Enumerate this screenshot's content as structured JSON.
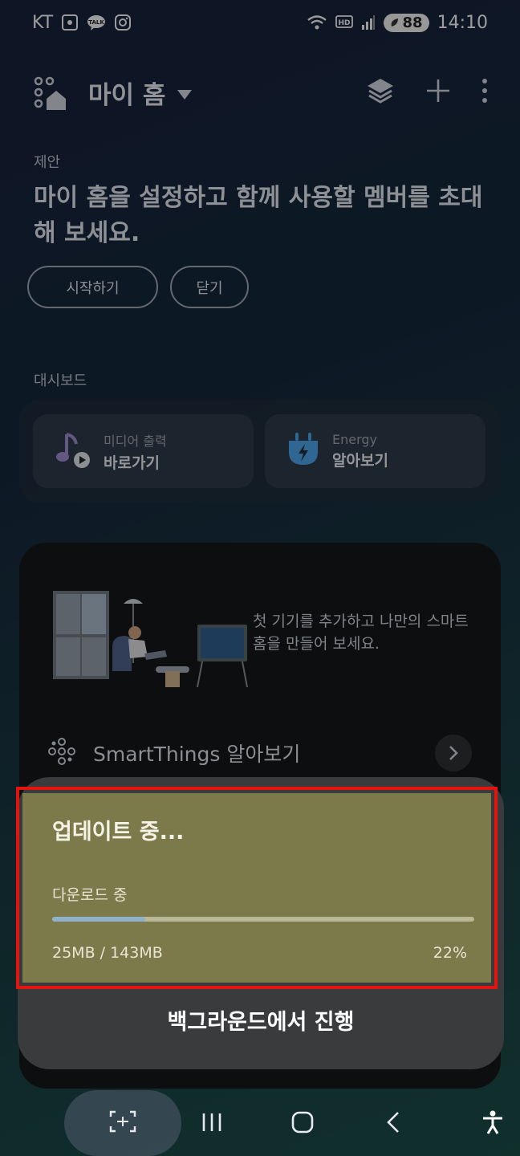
{
  "status_bar": {
    "carrier": "KT",
    "battery": "88",
    "time": "14:10"
  },
  "header": {
    "title": "마이 홈"
  },
  "suggestion": {
    "label": "제안",
    "text": "마이 홈을 설정하고 함께 사용할 멤버를 초대해 보세요.",
    "start_button": "시작하기",
    "close_button": "닫기"
  },
  "dashboard": {
    "label": "대시보드",
    "cards": [
      {
        "sub": "미디어 출력",
        "main": "바로가기"
      },
      {
        "sub": "Energy",
        "main": "알아보기"
      }
    ]
  },
  "device_card": {
    "message": "첫 기기를 추가하고 나만의 스마트 홈을 만들어 보세요.",
    "smartthings_label": "SmartThings 알아보기"
  },
  "update_dialog": {
    "title": "업데이트 중...",
    "subtitle": "다운로드 중",
    "progress": 0.22,
    "size_text": "25MB / 143MB",
    "percent_text": "22%",
    "background_button": "백그라운드에서 진행",
    "highlight_color": "#e3140d"
  },
  "icons": {
    "header": [
      "smartthings-home-icon",
      "dropdown-triangle-icon",
      "layers-icon",
      "plus-icon",
      "more-vert-icon"
    ],
    "nav": [
      "capture-icon",
      "recents-icon",
      "home-icon",
      "back-icon",
      "accessibility-icon"
    ]
  }
}
